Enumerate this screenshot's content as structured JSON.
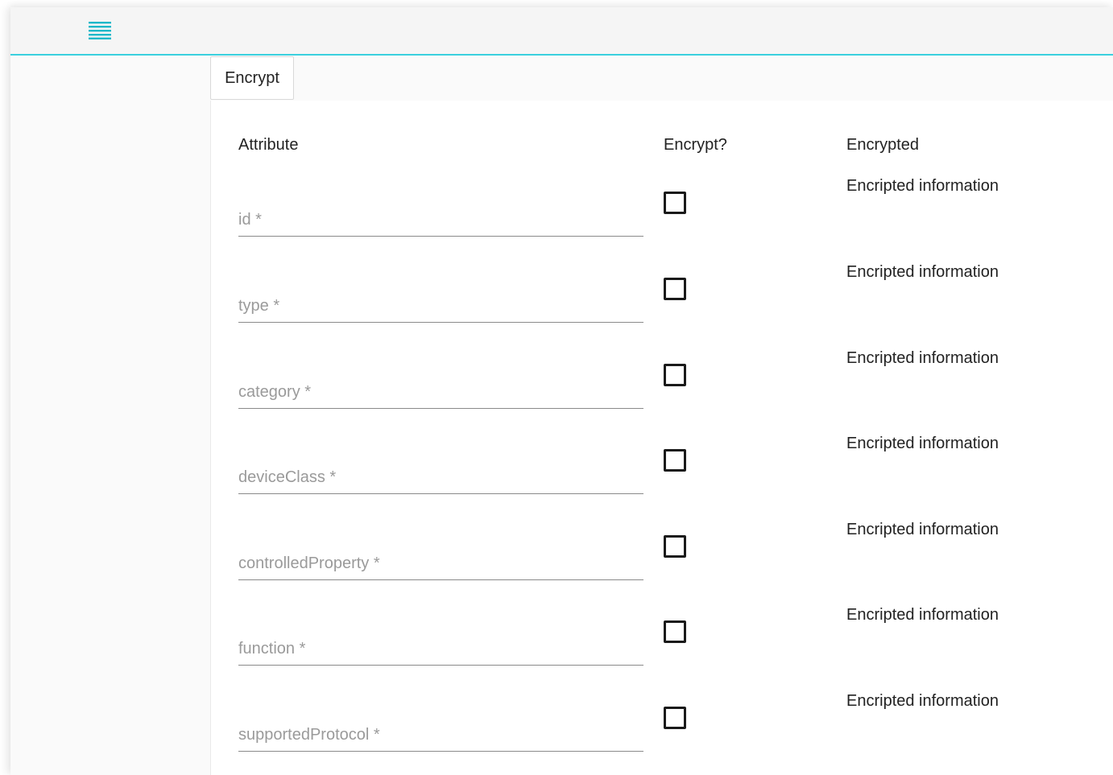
{
  "toolbar": {
    "menu_icon": "menu-icon",
    "accent_color": "#3ad0de"
  },
  "tabs": [
    {
      "label": "Encrypt"
    }
  ],
  "table": {
    "headers": {
      "attribute": "Attribute",
      "encrypt": "Encrypt?",
      "encrypted": "Encrypted"
    },
    "rows": [
      {
        "placeholder": "id *",
        "value": "",
        "checked": false,
        "encrypted": "Encripted information"
      },
      {
        "placeholder": "type *",
        "value": "",
        "checked": false,
        "encrypted": "Encripted information"
      },
      {
        "placeholder": "category *",
        "value": "",
        "checked": false,
        "encrypted": "Encripted information"
      },
      {
        "placeholder": "deviceClass *",
        "value": "",
        "checked": false,
        "encrypted": "Encripted information"
      },
      {
        "placeholder": "controlledProperty *",
        "value": "",
        "checked": false,
        "encrypted": "Encripted information"
      },
      {
        "placeholder": "function *",
        "value": "",
        "checked": false,
        "encrypted": "Encripted information"
      },
      {
        "placeholder": "supportedProtocol *",
        "value": "",
        "checked": false,
        "encrypted": "Encripted information"
      }
    ]
  }
}
